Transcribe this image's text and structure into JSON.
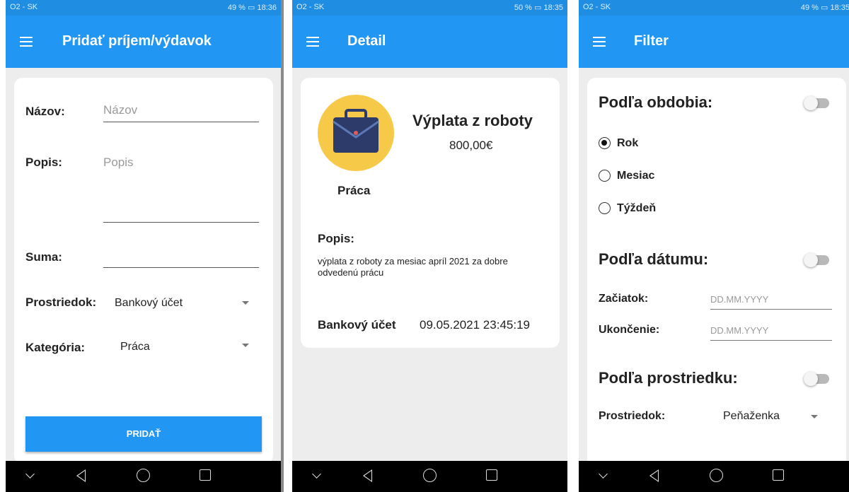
{
  "status_bars": [
    {
      "carrier": "O2 - SK",
      "indicators": "49 %",
      "time": "18:36"
    },
    {
      "carrier": "O2 - SK",
      "indicators": "50 %",
      "time": "18:35"
    },
    {
      "carrier": "O2 - SK",
      "indicators": "49 %",
      "time": "18:35"
    }
  ],
  "add_screen": {
    "title": "Pridať príjem/výdavok",
    "name_label": "Názov:",
    "name_placeholder": "Názov",
    "desc_label": "Popis:",
    "desc_placeholder": "Popis",
    "amount_label": "Suma:",
    "amount_value": "",
    "source_label": "Prostriedok:",
    "source_value": "Bankový účet",
    "category_label": "Kategória:",
    "category_value": "Práca",
    "submit_label": "PRIDAŤ"
  },
  "detail_screen": {
    "title": "Detail",
    "name": "Výplata z roboty",
    "amount": "800,00€",
    "category": "Práca",
    "category_icon": "briefcase-icon",
    "desc_label": "Popis:",
    "desc_text": "výplata z roboty za mesiac apríl 2021 za dobre odvedenú prácu",
    "source": "Bankový účet",
    "datetime": "09.05.2021 23:45:19"
  },
  "filter_screen": {
    "title": "Filter",
    "by_period": "Podľa obdobia:",
    "period_options": [
      "Rok",
      "Mesiac",
      "Týždeň"
    ],
    "period_selected": 0,
    "by_date": "Podľa dátumu:",
    "start_label": "Začiatok:",
    "start_placeholder": "DD.MM.YYYY",
    "end_label": "Ukončenie:",
    "end_placeholder": "DD.MM.YYYY",
    "by_source": "Podľa prostriedku:",
    "source_label": "Prostriedok:",
    "source_value": "Peňaženka"
  },
  "colors": {
    "app_bar": "#2196f3",
    "status_bar": "#1e8de2",
    "briefcase_bg": "#f7c948",
    "briefcase": "#2d3b6a"
  }
}
